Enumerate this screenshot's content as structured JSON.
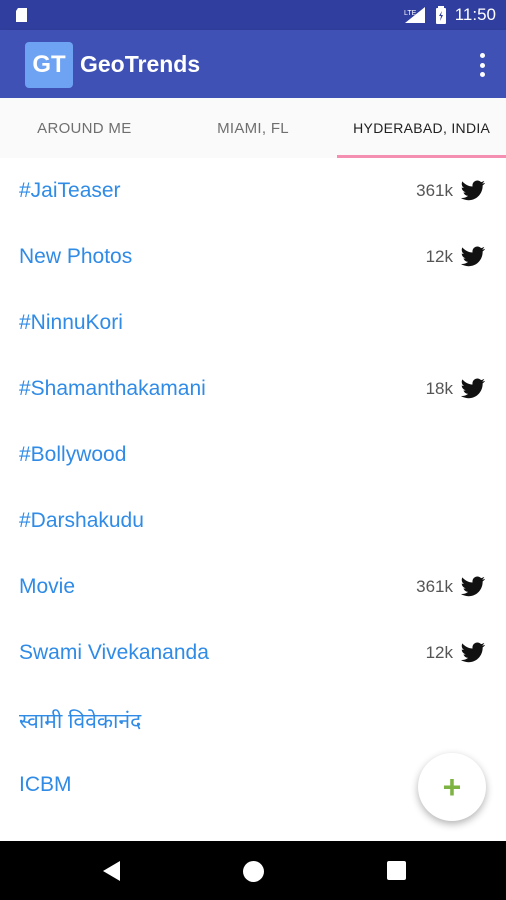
{
  "status_bar": {
    "time": "11:50",
    "network_label": "LTE"
  },
  "app_bar": {
    "logo_text": "GT",
    "title": "GeoTrends"
  },
  "tabs": [
    {
      "label": "AROUND ME",
      "active": false
    },
    {
      "label": "MIAMI, FL",
      "active": false
    },
    {
      "label": "HYDERABAD, INDIA",
      "active": true
    }
  ],
  "trends": [
    {
      "label": "#JaiTeaser",
      "count": "361k"
    },
    {
      "label": "New Photos",
      "count": "12k"
    },
    {
      "label": "#NinnuKori",
      "count": ""
    },
    {
      "label": "#Shamanthakamani",
      "count": "18k"
    },
    {
      "label": "#Bollywood",
      "count": ""
    },
    {
      "label": "#Darshakudu",
      "count": ""
    },
    {
      "label": "Movie",
      "count": "361k"
    },
    {
      "label": "Swami Vivekananda",
      "count": "12k"
    },
    {
      "label": "स्वामी विवेकानंद",
      "count": ""
    },
    {
      "label": "ICBM",
      "count": ""
    }
  ],
  "fab": {
    "label": "+"
  },
  "colors": {
    "primary": "#3f51b5",
    "primary_dark": "#303f9f",
    "accent": "#f48fb1",
    "link": "#2f8be6",
    "fab_plus": "#7cb342"
  }
}
